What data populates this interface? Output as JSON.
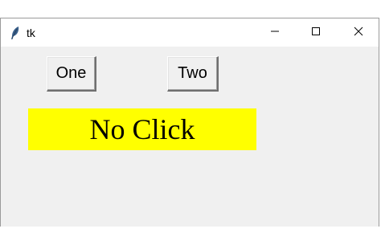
{
  "window": {
    "title": "tk"
  },
  "buttons": {
    "one_label": "One",
    "two_label": "Two"
  },
  "status_label": {
    "text": "No Click",
    "background": "#ffff00"
  },
  "icons": {
    "app": "feather-icon",
    "minimize": "minimize-icon",
    "maximize": "maximize-icon",
    "close": "close-icon"
  }
}
